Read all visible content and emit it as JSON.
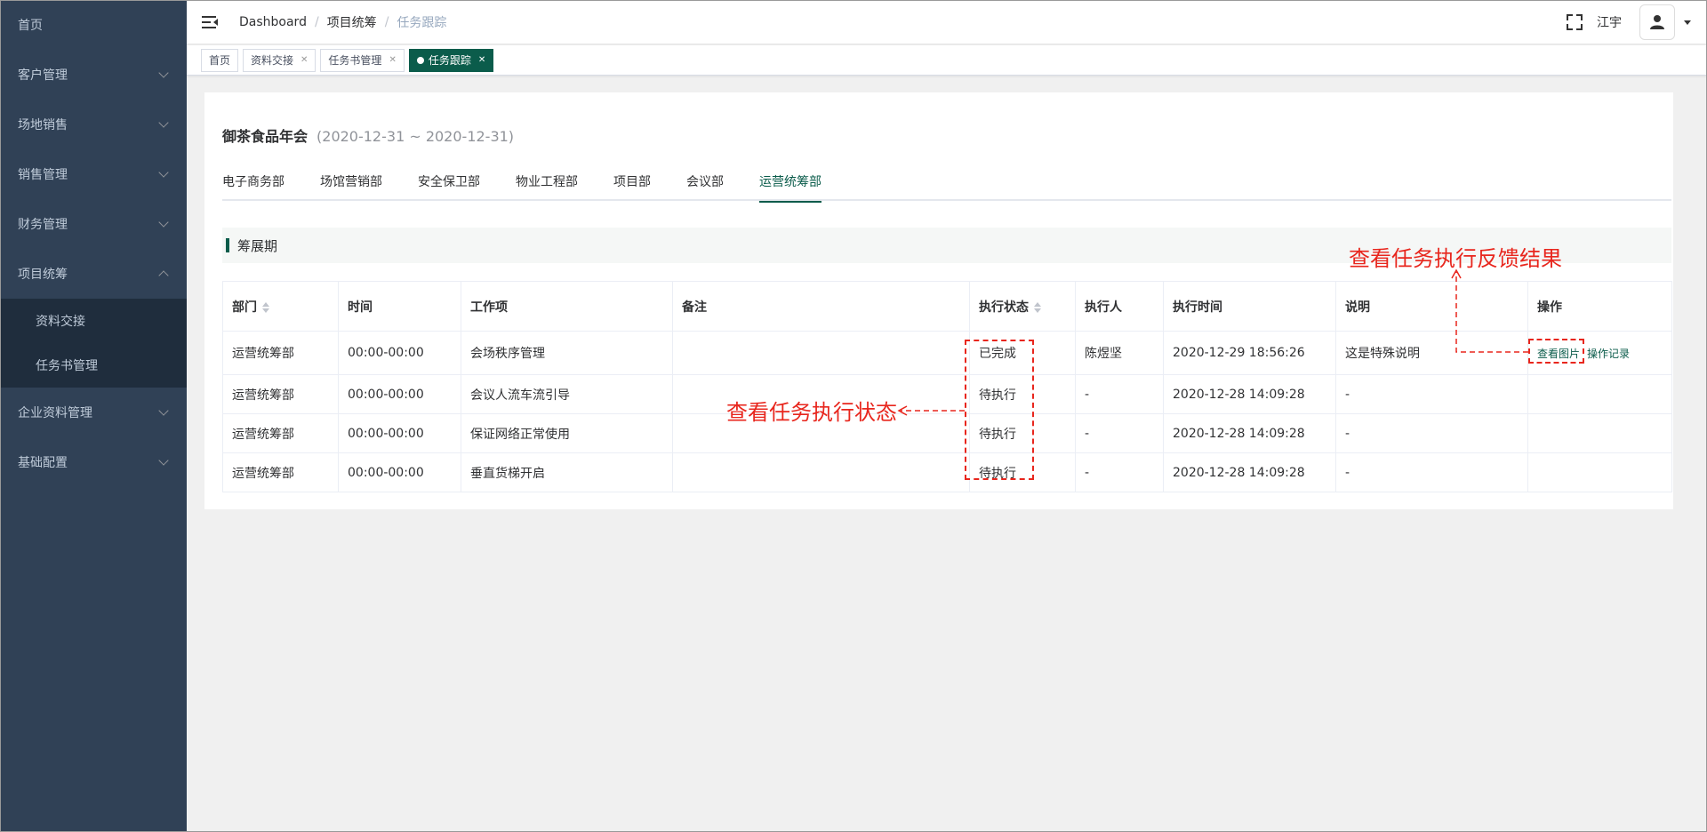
{
  "sidebar": {
    "items": [
      {
        "label": "首页",
        "has_arrow": false
      },
      {
        "label": "客户管理",
        "has_arrow": true
      },
      {
        "label": "场地销售",
        "has_arrow": true
      },
      {
        "label": "销售管理",
        "has_arrow": true
      },
      {
        "label": "财务管理",
        "has_arrow": true
      },
      {
        "label": "项目统筹",
        "has_arrow": true,
        "expanded": true
      },
      {
        "label": "企业资料管理",
        "has_arrow": true
      },
      {
        "label": "基础配置",
        "has_arrow": true
      }
    ],
    "sub_items": [
      "资料交接",
      "任务书管理"
    ]
  },
  "header": {
    "breadcrumb": [
      "Dashboard",
      "项目统筹",
      "任务跟踪"
    ],
    "username": "江宇"
  },
  "tags": [
    {
      "label": "首页",
      "closable": false,
      "active": false
    },
    {
      "label": "资料交接",
      "closable": true,
      "active": false
    },
    {
      "label": "任务书管理",
      "closable": true,
      "active": false
    },
    {
      "label": "任务跟踪",
      "closable": true,
      "active": true
    }
  ],
  "project": {
    "title": "御茶食品年会",
    "date_range": "(2020-12-31 ~ 2020-12-31)"
  },
  "dept_tabs": [
    "电子商务部",
    "场馆营销部",
    "安全保卫部",
    "物业工程部",
    "项目部",
    "会议部",
    "运营统筹部"
  ],
  "active_dept": "运营统筹部",
  "section": {
    "label": "筹展期"
  },
  "table": {
    "columns": [
      "部门",
      "时间",
      "工作项",
      "备注",
      "执行状态",
      "执行人",
      "执行时间",
      "说明",
      "操作"
    ],
    "rows": [
      [
        "运营统筹部",
        "00:00-00:00",
        "会场秩序管理",
        "",
        "已完成",
        "陈煜坚",
        "2020-12-29 18:56:26",
        "这是特殊说明"
      ],
      [
        "运营统筹部",
        "00:00-00:00",
        "会议人流车流引导",
        "",
        "待执行",
        "-",
        "2020-12-28 14:09:28",
        "-"
      ],
      [
        "运营统筹部",
        "00:00-00:00",
        "保证网络正常使用",
        "",
        "待执行",
        "-",
        "2020-12-28 14:09:28",
        "-"
      ],
      [
        "运营统筹部",
        "00:00-00:00",
        "垂直货梯开启",
        "",
        "待执行",
        "-",
        "2020-12-28 14:09:28",
        "-"
      ]
    ],
    "row_actions": [
      "查看图片",
      "操作记录"
    ]
  },
  "annotations": {
    "status_note": "查看任务执行状态",
    "feedback_note": "查看任务执行反馈结果",
    "color": "#e8261d"
  },
  "colors": {
    "sidebar_bg": "#304156",
    "sidebar_sub_bg": "#1f2d3d",
    "accent": "#0b5c4b"
  }
}
